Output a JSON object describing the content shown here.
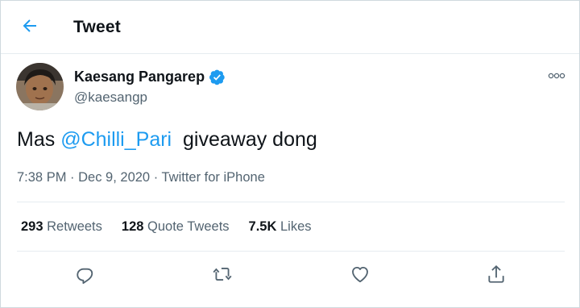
{
  "header": {
    "title": "Tweet",
    "back_icon": "arrow-left-icon"
  },
  "author": {
    "name": "Kaesang Pangarep",
    "handle": "@kaesangp",
    "verified_icon": "verified-badge-icon",
    "avatar_label": "profile photo"
  },
  "tweet": {
    "prefix": "Mas ",
    "mention": "@Chilli_Pari",
    "suffix": "  giveaway dong"
  },
  "meta": {
    "time": "7:38 PM",
    "separator": " · ",
    "date": "Dec 9, 2020",
    "source": "Twitter for iPhone"
  },
  "stats": {
    "retweets_count": "293",
    "retweets_label": " Retweets",
    "quotes_count": "128",
    "quotes_label": " Quote Tweets",
    "likes_count": "7.5K",
    "likes_label": " Likes"
  },
  "actions": [
    "reply-icon",
    "retweet-icon",
    "like-icon",
    "share-icon"
  ],
  "colors": {
    "accent": "#1d9bf0",
    "text": "#0f1419",
    "secondary": "#536471",
    "border": "#e6ecf0"
  }
}
